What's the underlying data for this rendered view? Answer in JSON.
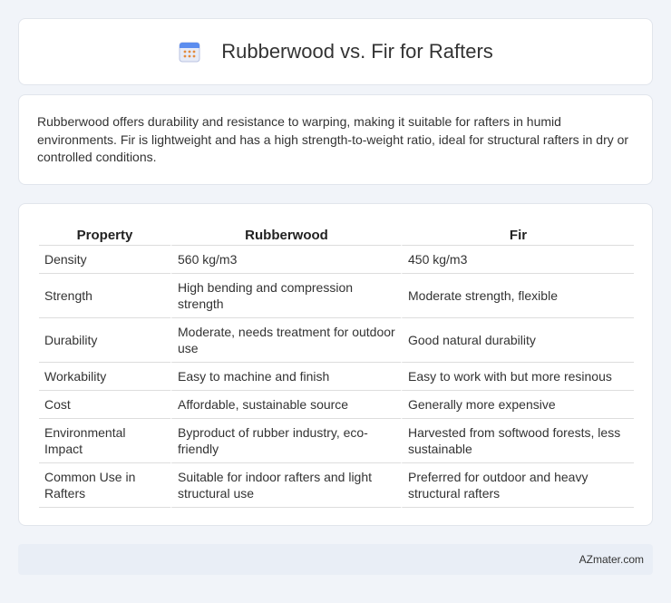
{
  "header": {
    "title": "Rubberwood vs. Fir for Rafters",
    "icon": "calendar-icon"
  },
  "intro": {
    "text": "Rubberwood offers durability and resistance to warping, making it suitable for rafters in humid environments. Fir is lightweight and has a high strength-to-weight ratio, ideal for structural rafters in dry or controlled conditions."
  },
  "table": {
    "headers": [
      "Property",
      "Rubberwood",
      "Fir"
    ],
    "rows": [
      [
        "Density",
        "560 kg/m3",
        "450 kg/m3"
      ],
      [
        "Strength",
        "High bending and compression strength",
        "Moderate strength, flexible"
      ],
      [
        "Durability",
        "Moderate, needs treatment for outdoor use",
        "Good natural durability"
      ],
      [
        "Workability",
        "Easy to machine and finish",
        "Easy to work with but more resinous"
      ],
      [
        "Cost",
        "Affordable, sustainable source",
        "Generally more expensive"
      ],
      [
        "Environmental Impact",
        "Byproduct of rubber industry, eco-friendly",
        "Harvested from softwood forests, less sustainable"
      ],
      [
        "Common Use in Rafters",
        "Suitable for indoor rafters and light structural use",
        "Preferred for outdoor and heavy structural rafters"
      ]
    ]
  },
  "footer": {
    "brand": "AZmater.com"
  }
}
